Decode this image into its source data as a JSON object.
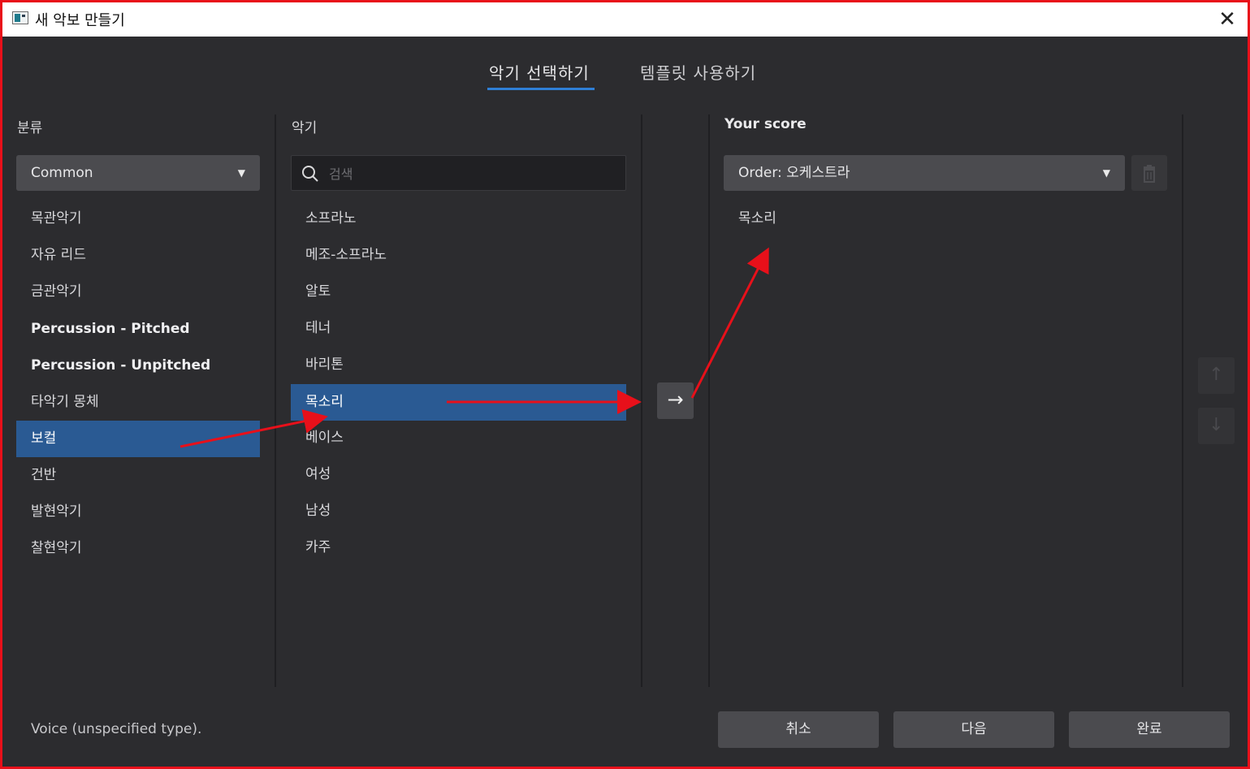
{
  "window": {
    "title": "새 악보 만들기"
  },
  "tabs": [
    {
      "label": "악기 선택하기",
      "active": true
    },
    {
      "label": "템플릿 사용하기",
      "active": false
    }
  ],
  "categories": {
    "heading": "분류",
    "filter_value": "Common",
    "items": [
      {
        "label": "목관악기"
      },
      {
        "label": "자유 리드"
      },
      {
        "label": "금관악기"
      },
      {
        "label": "Percussion - Pitched"
      },
      {
        "label": "Percussion - Unpitched"
      },
      {
        "label": "타악기 몽체"
      },
      {
        "label": "보컬",
        "selected": true
      },
      {
        "label": "건반"
      },
      {
        "label": "발현악기"
      },
      {
        "label": "찰현악기"
      }
    ]
  },
  "instruments": {
    "heading": "악기",
    "search_placeholder": "검색",
    "items": [
      {
        "label": "소프라노"
      },
      {
        "label": "메조-소프라노"
      },
      {
        "label": "알토"
      },
      {
        "label": "테너"
      },
      {
        "label": "바리톤"
      },
      {
        "label": "목소리",
        "selected": true
      },
      {
        "label": "베이스"
      },
      {
        "label": "여성"
      },
      {
        "label": "남성"
      },
      {
        "label": "카주"
      }
    ]
  },
  "add_button": {
    "icon": "arrow-right-icon",
    "glyph": "→"
  },
  "score": {
    "heading": "Your score",
    "order_value": "Order: 오케스트라",
    "items": [
      {
        "label": "목소리"
      }
    ]
  },
  "move_buttons": {
    "up_glyph": "↑",
    "down_glyph": "↓"
  },
  "status": {
    "text": "Voice (unspecified type)."
  },
  "footer": {
    "cancel": "취소",
    "next": "다음",
    "done": "완료"
  },
  "colors": {
    "accent": "#2f7fd6",
    "selection": "#2a5a93",
    "annotation": "#e8101a"
  }
}
